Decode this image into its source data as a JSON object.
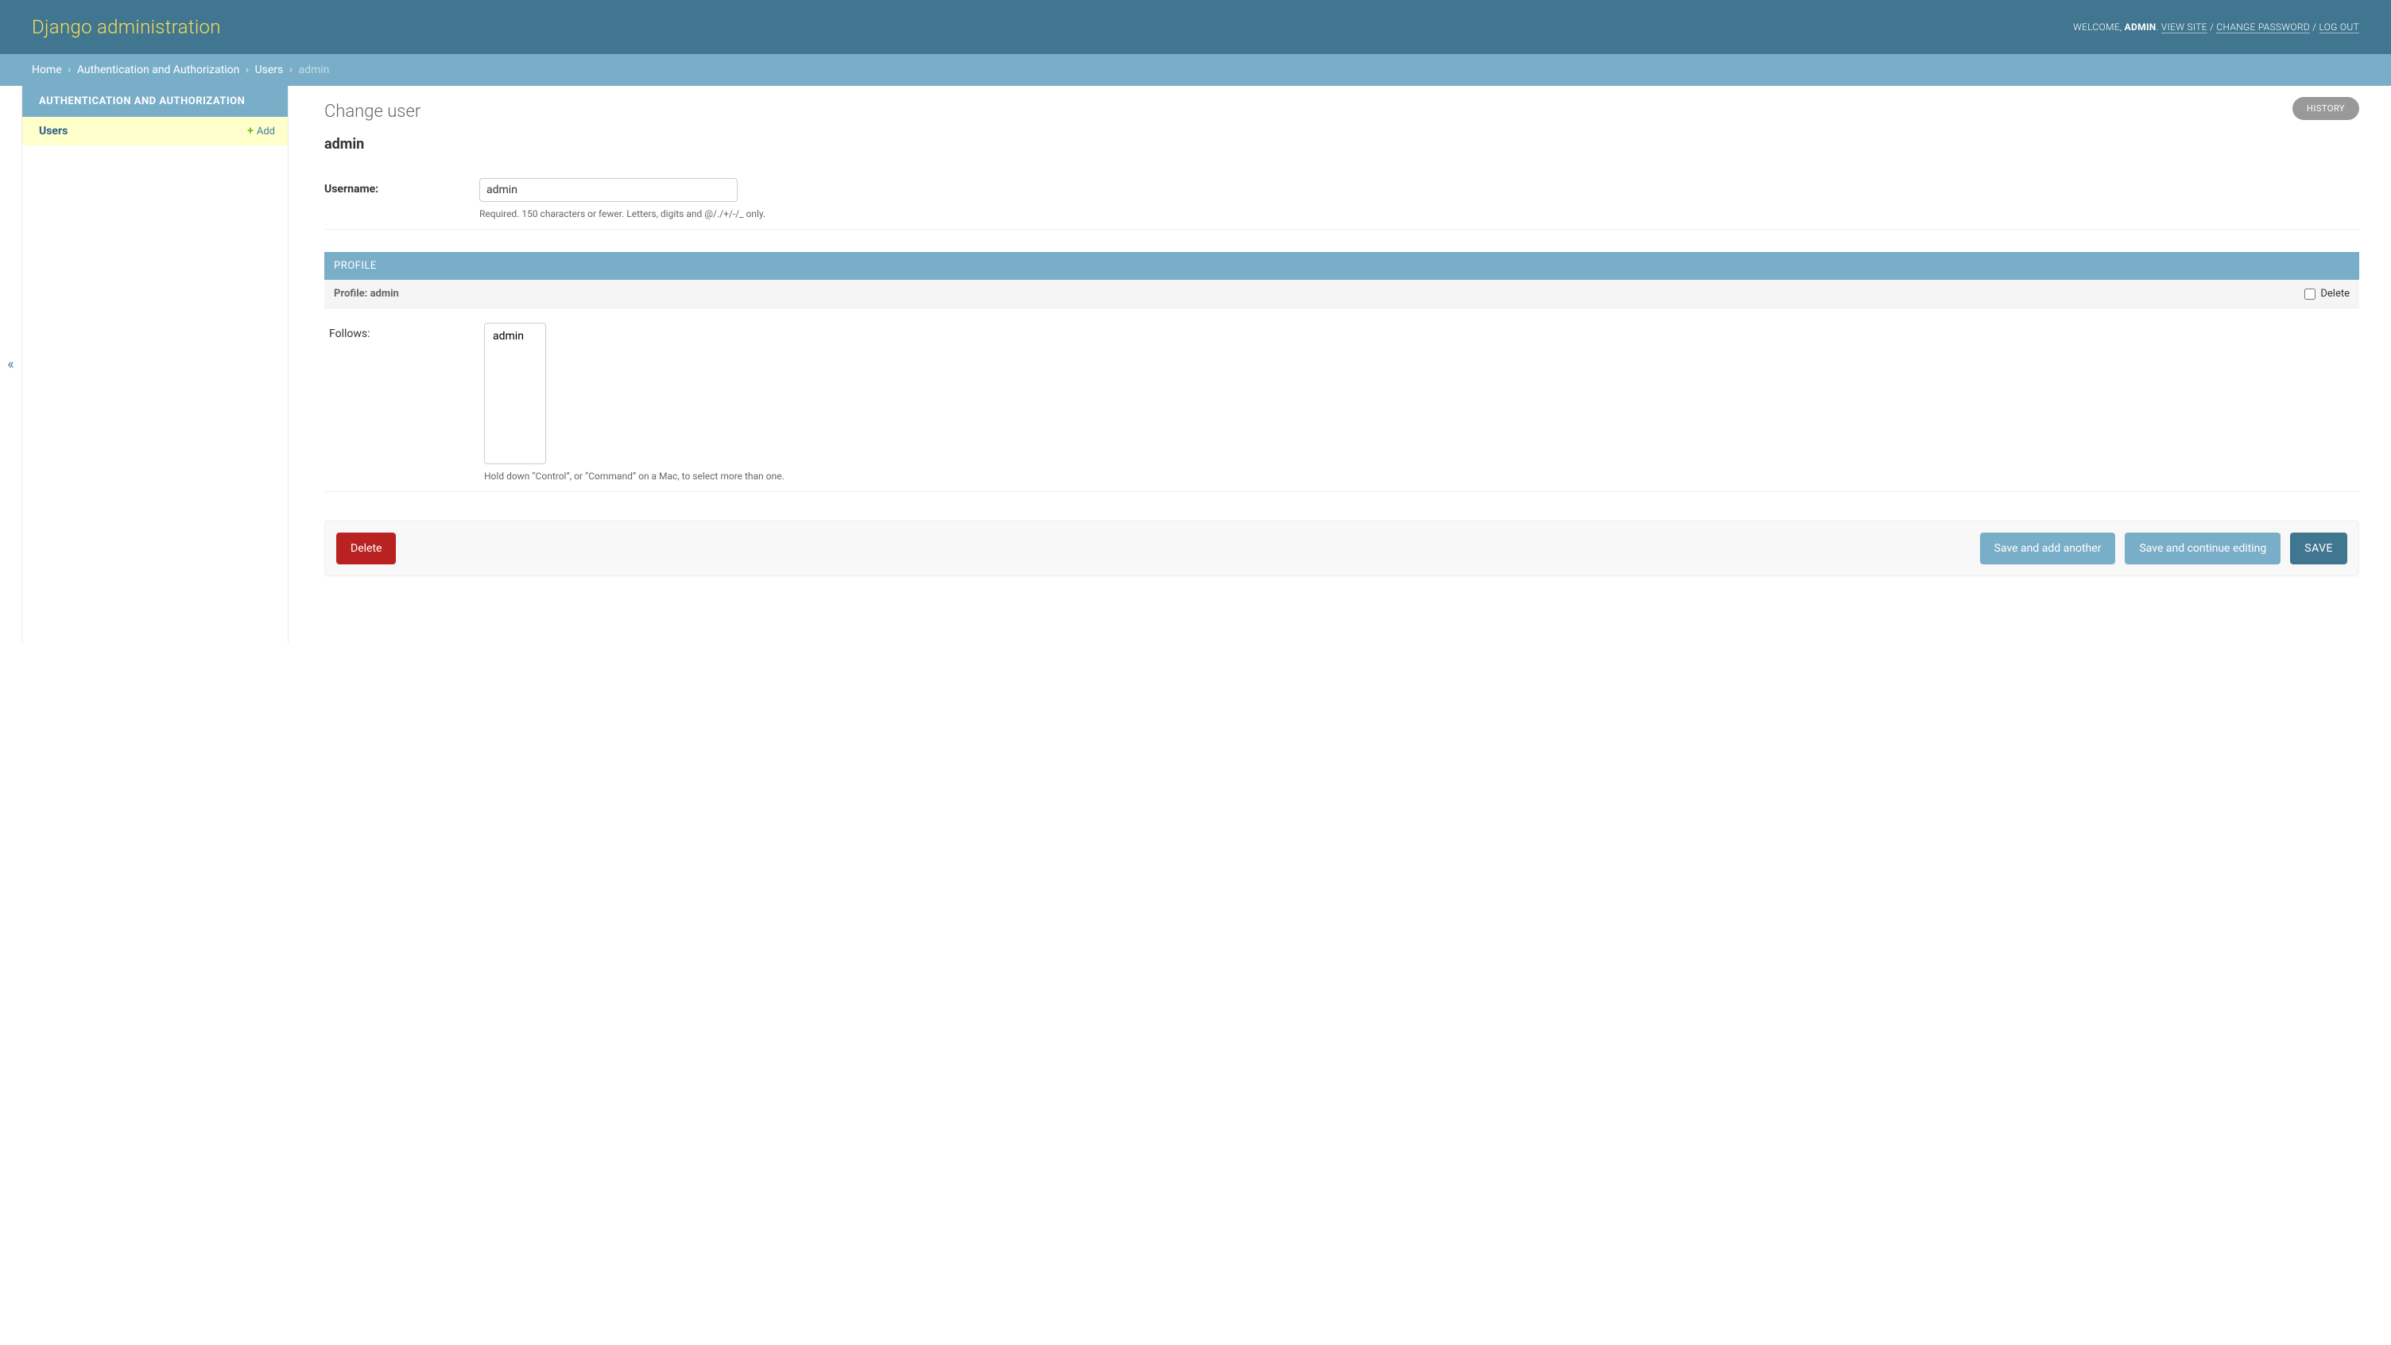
{
  "header": {
    "site_title": "Django administration",
    "welcome_prefix": "WELCOME, ",
    "username": "ADMIN",
    "view_site": "VIEW SITE",
    "change_password": "CHANGE PASSWORD",
    "log_out": "LOG OUT"
  },
  "breadcrumbs": {
    "home": "Home",
    "app": "Authentication and Authorization",
    "model": "Users",
    "current": "admin",
    "separator": "›"
  },
  "sidebar": {
    "toggle_glyph": "«",
    "section_caption": "AUTHENTICATION AND AUTHORIZATION",
    "items": [
      {
        "label": "Users",
        "add_label": "Add",
        "plus": "+"
      }
    ]
  },
  "page": {
    "title": "Change user",
    "history_label": "HISTORY",
    "object_name": "admin"
  },
  "fields": {
    "username": {
      "label": "Username:",
      "value": "admin",
      "help": "Required. 150 characters or fewer. Letters, digits and @/./+/-/_ only."
    }
  },
  "inline": {
    "heading": "PROFILE",
    "subheading": "Profile: admin",
    "delete_label": "Delete",
    "follows": {
      "label": "Follows:",
      "options": [
        "admin"
      ],
      "help": "Hold down “Control”, or “Command” on a Mac, to select more than one."
    }
  },
  "submit": {
    "delete": "Delete",
    "save_add_another": "Save and add another",
    "save_continue": "Save and continue editing",
    "save": "SAVE"
  }
}
